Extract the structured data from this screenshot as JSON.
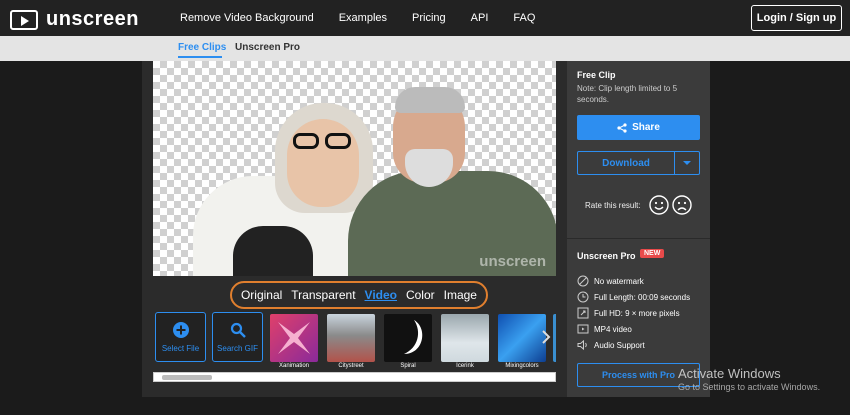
{
  "header": {
    "logo_text": "unscreen",
    "nav": [
      "Remove Video Background",
      "Examples",
      "Pricing",
      "API",
      "FAQ"
    ],
    "login_label": "Login / Sign up"
  },
  "subnav": {
    "tabs": [
      "Free Clips",
      "Unscreen Pro"
    ],
    "active": "Free Clips"
  },
  "preview": {
    "watermark": "unscreen"
  },
  "view_tabs": {
    "items": [
      "Original",
      "Transparent",
      "Video",
      "Color",
      "Image"
    ],
    "active": "Video"
  },
  "strip": {
    "tools": [
      {
        "label": "Select File",
        "icon": "plus-circle-icon"
      },
      {
        "label": "Search GIF",
        "icon": "search-icon"
      }
    ],
    "thumbnails": [
      {
        "label": "Xanimation",
        "color": "#e0406a"
      },
      {
        "label": "Citystreet",
        "color": "#9a7c78"
      },
      {
        "label": "Spiral",
        "color": "#111111"
      },
      {
        "label": "Icerink",
        "color": "#c8d3d8"
      },
      {
        "label": "Mixingcolors",
        "color": "#1a6fd0"
      }
    ]
  },
  "sidebar": {
    "title": "Free Clip",
    "note": "Note: Clip length limited to 5 seconds.",
    "share_label": "Share",
    "download_label": "Download",
    "rate_label": "Rate this result:",
    "pro_title": "Unscreen Pro",
    "pro_badge": "NEW",
    "features": [
      {
        "icon": "no-watermark-icon",
        "text": "No watermark"
      },
      {
        "icon": "clock-icon",
        "text": "Full Length: 00:09 seconds"
      },
      {
        "icon": "expand-icon",
        "text": "Full HD: 9 × more pixels"
      },
      {
        "icon": "video-icon",
        "text": "MP4 video"
      },
      {
        "icon": "speaker-icon",
        "text": "Audio Support"
      }
    ],
    "pro_button_label": "Process with Pro"
  },
  "windows_watermark": {
    "title": "Activate Windows",
    "subtitle": "Go to Settings to activate Windows."
  },
  "colors": {
    "accent": "#2d8ef0",
    "highlight_ring": "#e07f2e",
    "badge": "#e84a4a"
  }
}
